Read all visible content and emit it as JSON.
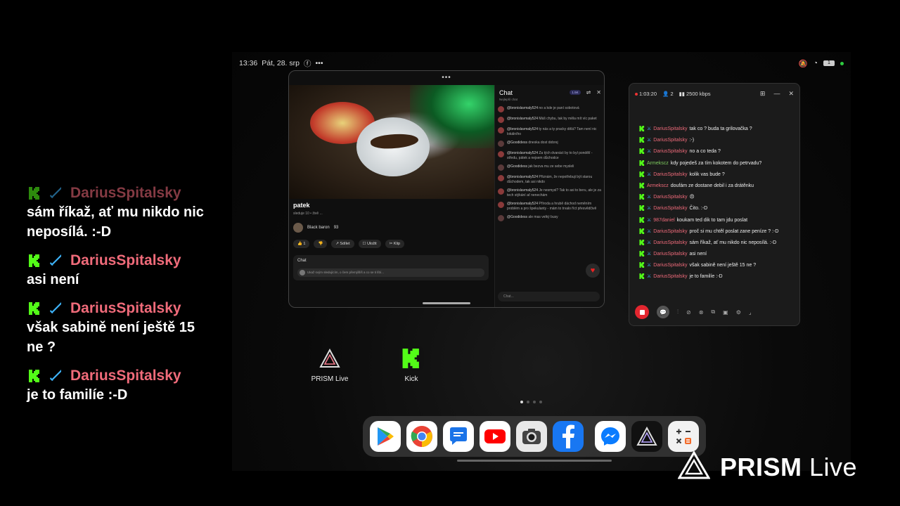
{
  "overlay_chat": [
    {
      "user": "DariusSpitalsky",
      "text": "sám říkaž, ať mu nikdo nic neposílá. :-D"
    },
    {
      "user": "DariusSpitalsky",
      "text": "asi není"
    },
    {
      "user": "DariusSpitalsky",
      "text": "však sabině není ještě 15 ne ?"
    },
    {
      "user": "DariusSpitalsky",
      "text": "je to familíe :-D"
    }
  ],
  "status_bar": {
    "time": "13:36",
    "date": "Pát, 28. srp",
    "extra": "•••",
    "battery": "1"
  },
  "youtube": {
    "window_dots": "•••",
    "video_title": "patek",
    "video_sub": "sleduje 10 • živě ...",
    "channel": "Black baron",
    "channel_subs": "93",
    "actions": [
      "👍 1",
      "👎",
      "↗ Sdílet",
      "☐ Uložit",
      "✂ Klip"
    ],
    "chat_label": "Chat",
    "chat_placeholder": "Ukaž svým sledujícím, o čem přemýšlíš a co se ti líbí...",
    "live_chat": {
      "title": "Chat",
      "subtitle": "Nejlepší chat",
      "badge": "1.5K",
      "messages": [
        {
          "user": "@bronislavmaly524",
          "text": "no a kde je paní sobotová"
        },
        {
          "user": "@bronislavmaly524",
          "text": "Máš chybu, tak by měla mít víc paket"
        },
        {
          "user": "@bronislavmaly524",
          "text": "ty nás a ty pracky dělá? Tam není nic lokálního"
        },
        {
          "user": "@Goodidess",
          "text": "dneska dost dobrej"
        },
        {
          "user": "@bronislavmaly524",
          "text": "Za tých dvanáct by to byl pondělí - středu, pátek a nejsem důchodce"
        },
        {
          "user": "@Goodidess",
          "text": "jak bezva mu ze sebe mysleli"
        },
        {
          "user": "@bronislavmaly524",
          "text": "Přiznám, že nepotřebuji být starou důchodem, tak asi nikdo"
        },
        {
          "user": "@bronislavmaly524",
          "text": "Je nesmysl? Tak to asi to beru, ale je za tech stýkání ať nenechám"
        },
        {
          "user": "@bronislavmaly524",
          "text": "Příroda a hrubě dáchod neměním problém a pro špekulanty - mám to trvalo říct přesvědčivě"
        },
        {
          "user": "@Goodidess",
          "text": "ale mas velký busy"
        }
      ],
      "input_placeholder": "Chat..."
    }
  },
  "prism": {
    "duration": "1:03:20",
    "viewers": "2",
    "bitrate": "2500 kbps",
    "messages": [
      {
        "user": "DariusSpitalsky",
        "text": "tak co ? buda ta grilovačka ?",
        "color": "pink"
      },
      {
        "user": "DariusSpitalsky",
        "text": ":-)",
        "color": "pink"
      },
      {
        "user": "DariusSpitalsky",
        "text": "no a co teda ?",
        "color": "pink"
      },
      {
        "user": "Armekscz",
        "text": "kdy pojedeš za tím kokotem do petrvadu?",
        "color": "green"
      },
      {
        "user": "DariusSpitalsky",
        "text": "kolik vas bude ?",
        "color": "pink"
      },
      {
        "user": "Armekscz",
        "text": "doufám ze dostane debil i za drátěnku",
        "color": "pink"
      },
      {
        "user": "DariusSpitalsky",
        "text": "😠",
        "color": "pink"
      },
      {
        "user": "DariusSpitalsky",
        "text": "Čito. :-D",
        "color": "pink"
      },
      {
        "user": "987daniel",
        "text": "koukam ted dik to tam jdu poslat",
        "color": "pink"
      },
      {
        "user": "DariusSpitalsky",
        "text": "proč si mu chtěl poslat zane peníze ? :-D",
        "color": "pink"
      },
      {
        "user": "DariusSpitalsky",
        "text": "sám říkaž, ať mu nikdo nic neposílá. :-D",
        "color": "pink"
      },
      {
        "user": "DariusSpitalsky",
        "text": "asi není",
        "color": "pink"
      },
      {
        "user": "DariusSpitalsky",
        "text": "však sabině není ještě 15 ne ?",
        "color": "pink"
      },
      {
        "user": "DariusSpitalsky",
        "text": "je to familíe :-D",
        "color": "pink"
      }
    ]
  },
  "home_apps": [
    {
      "label": "PRISM Live"
    },
    {
      "label": "Kick"
    }
  ],
  "dock_apps": [
    "play-store",
    "chrome",
    "messages",
    "youtube",
    "camera",
    "facebook",
    "messenger",
    "prism-live",
    "calculator"
  ],
  "watermark": {
    "brand": "PRISM",
    "suffix": "Live"
  },
  "colors": {
    "kick_green": "#53fc18",
    "username_pink": "#f06b7a",
    "stop_red": "#e3262f"
  }
}
